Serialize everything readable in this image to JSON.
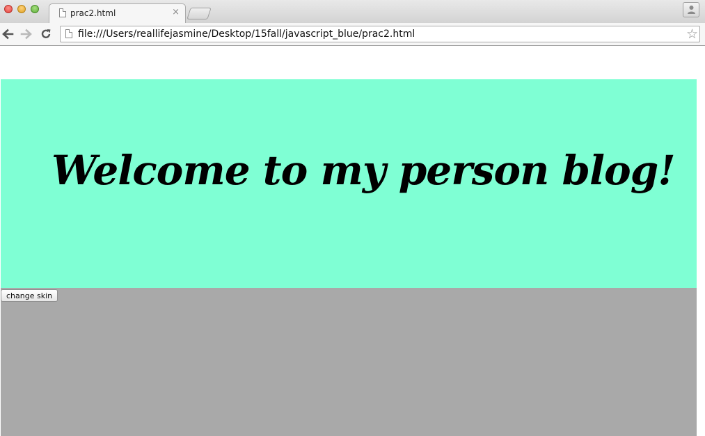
{
  "browser": {
    "tab": {
      "title": "prac2.html",
      "close_glyph": "×"
    },
    "address_bar": {
      "url": "file:///Users/reallifejasmine/Desktop/15fall/javascript_blue/prac2.html",
      "bookmark_glyph": "☆"
    },
    "icons": {
      "back": "back-arrow-icon",
      "forward": "forward-arrow-icon",
      "reload": "reload-icon",
      "profile": "person-icon",
      "page": "page-icon"
    }
  },
  "page": {
    "banner": {
      "title": "Welcome to my person blog!",
      "background": "#7fffd4"
    },
    "content": {
      "background": "#a9a9a9",
      "button_label": "change skin"
    }
  }
}
